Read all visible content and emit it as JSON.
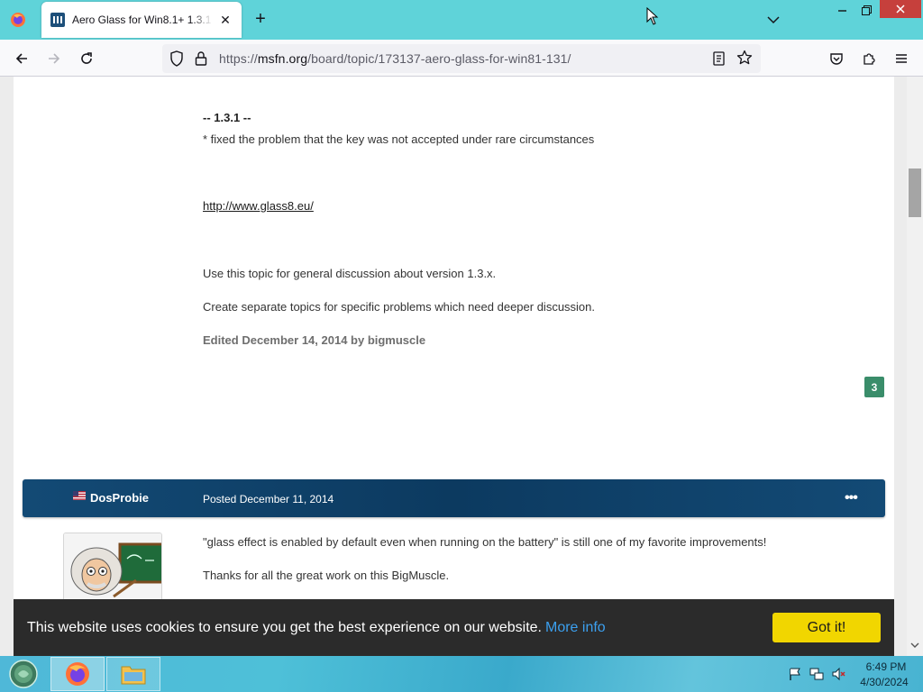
{
  "browser": {
    "tab_title": "Aero Glass for Win8.1+ 1.3.1 - A",
    "url_prefix": "https://",
    "url_host": "msfn.org",
    "url_path": "/board/topic/173137-aero-glass-for-win81-131/",
    "new_tab_symbol": "+",
    "close_symbol": "✕"
  },
  "post": {
    "version_heading": "-- 1.3.1 --",
    "fix_line": "* fixed the problem that the key was not accepted under rare circumstances",
    "link_text": "http://www.glass8.eu/",
    "discuss_line": "Use this topic for general discussion about version 1.3.x.",
    "separate_line": "Create separate topics for specific problems which need deeper discussion.",
    "edited_line": "Edited December 14, 2014 by bigmuscle",
    "reputation": "3"
  },
  "reply": {
    "author": "DosProbie",
    "date": "Posted December 11, 2014",
    "menu": "•••",
    "line1": "\"glass effect is enabled by default even when running on the battery\"  is still one of my favorite improvements!",
    "line2": "Thanks for all the great work on this BigMuscle."
  },
  "cookie": {
    "message": "This website uses cookies to ensure you get the best experience on our website.",
    "more_info": "More info",
    "button": "Got it!"
  },
  "taskbar": {
    "time": "6:49 PM",
    "date": "4/30/2024"
  },
  "colors": {
    "tabstrip": "#5fd3d9",
    "post_header": "#0e3f67",
    "reputation_badge": "#3a8d6a",
    "cookie_button": "#f1d600",
    "cookie_link": "#3ca0ef"
  }
}
